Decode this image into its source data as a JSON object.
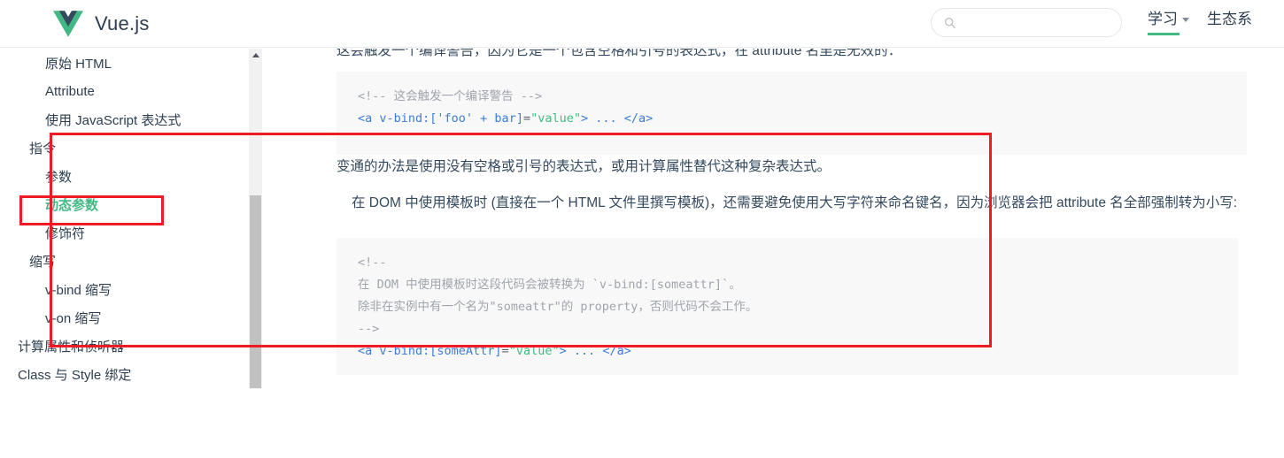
{
  "header": {
    "brand_text": "Vue.js",
    "logo_icon": "vue-logo-icon",
    "search": {
      "icon": "search-icon",
      "placeholder": "",
      "value": ""
    },
    "nav": [
      {
        "label": "学习",
        "has_caret": true,
        "active": true
      },
      {
        "label": "生态系",
        "has_caret": false,
        "active": false
      }
    ]
  },
  "sidebar": {
    "items": [
      {
        "label": "原始 HTML",
        "level": 2,
        "active": false
      },
      {
        "label": "Attribute",
        "level": 2,
        "active": false
      },
      {
        "label": "使用 JavaScript 表达式",
        "level": 2,
        "active": false
      },
      {
        "label": "指令",
        "level": 1,
        "active": false
      },
      {
        "label": "参数",
        "level": 2,
        "active": false
      },
      {
        "label": "动态参数",
        "level": 2,
        "active": true
      },
      {
        "label": "修饰符",
        "level": 2,
        "active": false
      },
      {
        "label": "缩写",
        "level": 1,
        "active": false
      },
      {
        "label": "v-bind 缩写",
        "level": 2,
        "active": false
      },
      {
        "label": "v-on 缩写",
        "level": 2,
        "active": false
      },
      {
        "label": "计算属性和侦听器",
        "level": 0,
        "active": false
      },
      {
        "label": "Class 与 Style 绑定",
        "level": 0,
        "active": false
      }
    ],
    "scrollbar": {
      "up_arrow_icon": "scroll-up-arrow-icon"
    }
  },
  "main": {
    "cut_off_line": "这会触发一个编译警告，因为它是一个包含空格和引号的表达式，在 attribute 名里是无效的：",
    "code_block_1": {
      "lines": [
        {
          "segments": [
            {
              "text": "<!-- 这会触发一个编译警告 -->",
              "cls": "c-comment"
            }
          ]
        },
        {
          "segments": [
            {
              "text": "<a ",
              "cls": "c-tag"
            },
            {
              "text": "v-bind:['foo' + bar]",
              "cls": "c-attr"
            },
            {
              "text": "=",
              "cls": "c-plain"
            },
            {
              "text": "\"value\"",
              "cls": "c-string"
            },
            {
              "text": "> ... </a>",
              "cls": "c-tag"
            }
          ]
        }
      ]
    },
    "paragraph_1": "变通的办法是使用没有空格或引号的表达式，或用计算属性替代这种复杂表达式。",
    "paragraph_2": "在 DOM 中使用模板时 (直接在一个 HTML 文件里撰写模板)，还需要避免使用大写字符来命名键名，因为浏览器会把 attribute 名全部强制转为小写:",
    "code_block_2": {
      "lines": [
        {
          "segments": [
            {
              "text": "<!--",
              "cls": "c-comment"
            }
          ]
        },
        {
          "segments": [
            {
              "text": "在 DOM 中使用模板时这段代码会被转换为 `v-bind:[someattr]`。",
              "cls": "c-comment"
            }
          ]
        },
        {
          "segments": [
            {
              "text": "除非在实例中有一个名为\"someattr\"的 property，否则代码不会工作。",
              "cls": "c-comment"
            }
          ]
        },
        {
          "segments": [
            {
              "text": "-->",
              "cls": "c-comment"
            }
          ]
        },
        {
          "segments": [
            {
              "text": "<a ",
              "cls": "c-tag"
            },
            {
              "text": "v-bind:[someAttr]",
              "cls": "c-attr"
            },
            {
              "text": "=",
              "cls": "c-plain"
            },
            {
              "text": "\"value\"",
              "cls": "c-string"
            },
            {
              "text": "> ... </a>",
              "cls": "c-tag"
            }
          ]
        }
      ]
    }
  },
  "annotations": {
    "sidebar_highlight_color": "#ed1c24",
    "content_highlight_color": "#ed1c24"
  },
  "colors": {
    "accent_green": "#42b983",
    "text_dark": "#2c3e50",
    "code_bg": "#f8f8f8"
  }
}
